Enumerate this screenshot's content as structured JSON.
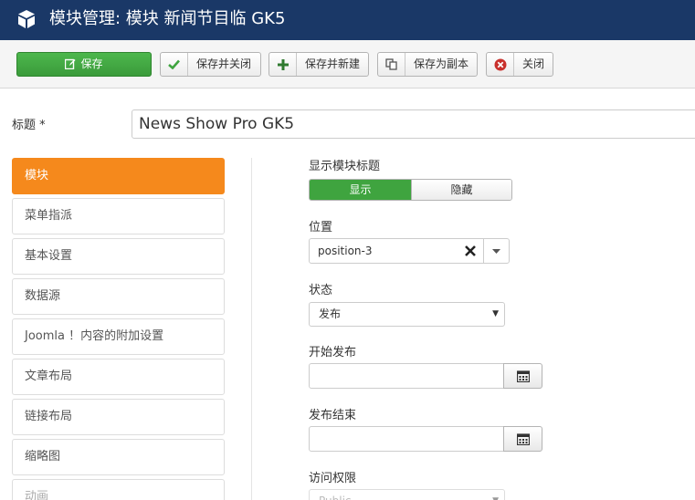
{
  "header": {
    "title": "模块管理: 模块 新闻节目临 GK5",
    "icon": "cube-icon"
  },
  "toolbar": {
    "save": "保存",
    "save_close": "保存并关闭",
    "save_new": "保存并新建",
    "save_copy": "保存为副本",
    "close": "关闭",
    "colors": {
      "save_bg": "#3b9b3b",
      "check": "#3fa43f",
      "plus": "#3a7a3a",
      "close_icon": "#c9302c"
    }
  },
  "form": {
    "title_label": "标题 *",
    "title_value": "News Show Pro GK5"
  },
  "sidebar": {
    "items": [
      {
        "label": "模块",
        "active": true
      },
      {
        "label": "菜单指派"
      },
      {
        "label": "基本设置"
      },
      {
        "label": "数据源"
      },
      {
        "label": "Joomla ！内容的附加设置"
      },
      {
        "label": "文章布局"
      },
      {
        "label": "链接布局"
      },
      {
        "label": "缩略图"
      },
      {
        "label": "动画"
      }
    ],
    "active_color": "#f5891c"
  },
  "fields": {
    "show_title_label": "显示模块标题",
    "show_option": "显示",
    "hide_option": "隐藏",
    "position_label": "位置",
    "position_value": "position-3",
    "status_label": "状态",
    "status_value": "发布",
    "start_label": "开始发布",
    "end_label": "发布结束",
    "access_label": "访问权限",
    "access_value": "Public"
  }
}
